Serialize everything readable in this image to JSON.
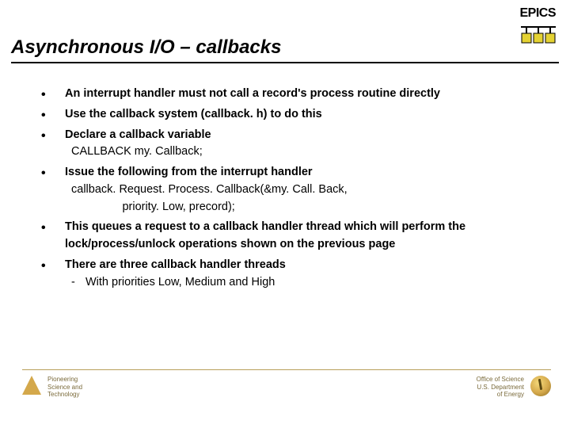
{
  "header": {
    "epics_label": "EPICS",
    "title": "Asynchronous I/O – callbacks"
  },
  "bullets": [
    {
      "text": "An interrupt handler must not call a record's process routine directly"
    },
    {
      "text": "Use the callback system (callback. h) to do this"
    },
    {
      "text": "Declare a callback variable",
      "plain": "CALLBACK my. Callback;"
    },
    {
      "text": "Issue the following from the interrupt handler",
      "plain": "callback. Request. Process. Callback(&my. Call. Back,\n                priority. Low, precord);"
    },
    {
      "text": "This queues a request to a callback handler thread which will perform the lock/process/unlock operations shown on the previous page"
    },
    {
      "text": "There are three callback handler threads",
      "sub": "With priorities Low, Medium and High"
    }
  ],
  "footer": {
    "argonne": "Pioneering\nScience and\nTechnology",
    "osc": "Office of Science\nU.S. Department\nof Energy"
  }
}
